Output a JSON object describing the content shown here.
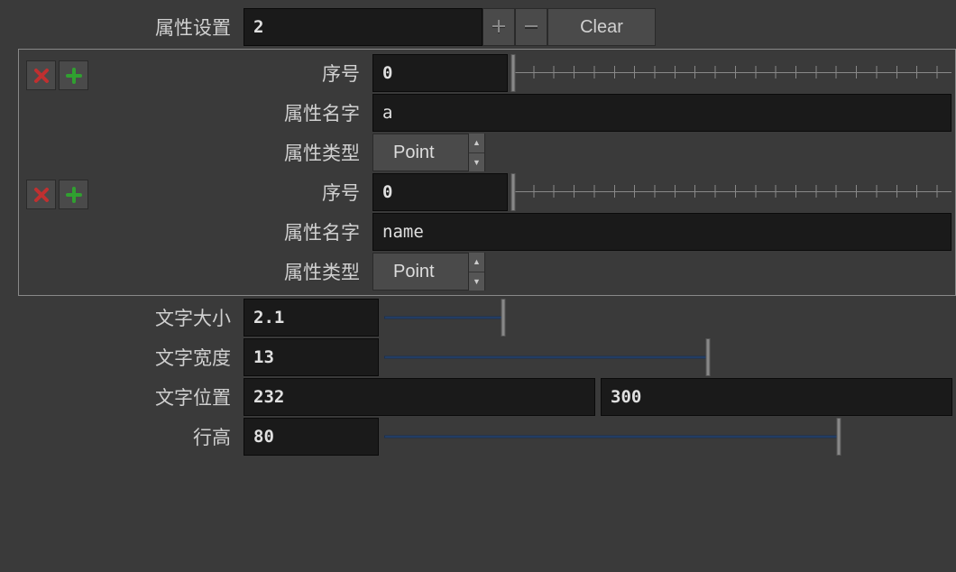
{
  "attrSettings": {
    "label": "属性设置",
    "value": "2",
    "clearLabel": "Clear"
  },
  "attributes": [
    {
      "indexLabel": "序号",
      "indexValue": "0",
      "nameLabel": "属性名字",
      "nameValue": "a",
      "typeLabel": "属性类型",
      "typeValue": "Point",
      "sliderPos": 0
    },
    {
      "indexLabel": "序号",
      "indexValue": "0",
      "nameLabel": "属性名字",
      "nameValue": "name",
      "typeLabel": "属性类型",
      "typeValue": "Point",
      "sliderPos": 0
    }
  ],
  "textSize": {
    "label": "文字大小",
    "value": "2.1",
    "sliderPos": 21
  },
  "textWidth": {
    "label": "文字宽度",
    "value": "13",
    "sliderPos": 57
  },
  "textPos": {
    "label": "文字位置",
    "x": "232",
    "y": "300"
  },
  "lineHeight": {
    "label": "行高",
    "value": "80",
    "sliderPos": 80
  }
}
